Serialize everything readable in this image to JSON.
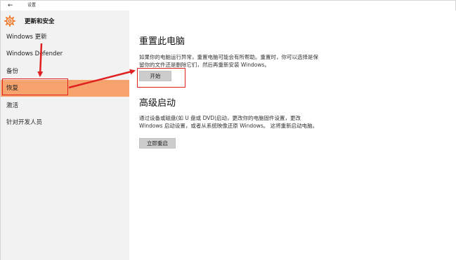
{
  "titlebar": {
    "back_glyph": "←",
    "title": "设置"
  },
  "sidebar": {
    "section_icon": "gear-icon",
    "section_title": "更新和安全",
    "items": [
      {
        "label": "Windows 更新",
        "active": false
      },
      {
        "label": "Windows Defender",
        "active": false
      },
      {
        "label": "备份",
        "active": false
      },
      {
        "label": "恢复",
        "active": true
      },
      {
        "label": "激活",
        "active": false
      },
      {
        "label": "针对开发人员",
        "active": false
      }
    ]
  },
  "reset": {
    "heading": "重置此电脑",
    "description": "如果你的电脑运行异常，重置电脑可能会有所帮助。重置时，你可以选择是保留你的文件还是删除它们，然后再重新安装 Windows。",
    "button_label": "开始"
  },
  "advanced": {
    "heading": "高级启动",
    "description": "通过设备或磁盘(如 U 盘或 DVD)启动，更改你的电脑固件设置，更改 Windows 启动设置，或者从系统映像还原 Windows。 这将重新启动电脑。",
    "button_label": "立即重启"
  },
  "colors": {
    "accent_orange": "#f07a2e",
    "active_item_bg": "#f7a36e",
    "annotation_red": "#e02020",
    "sidebar_bg": "#f2f2f2"
  }
}
